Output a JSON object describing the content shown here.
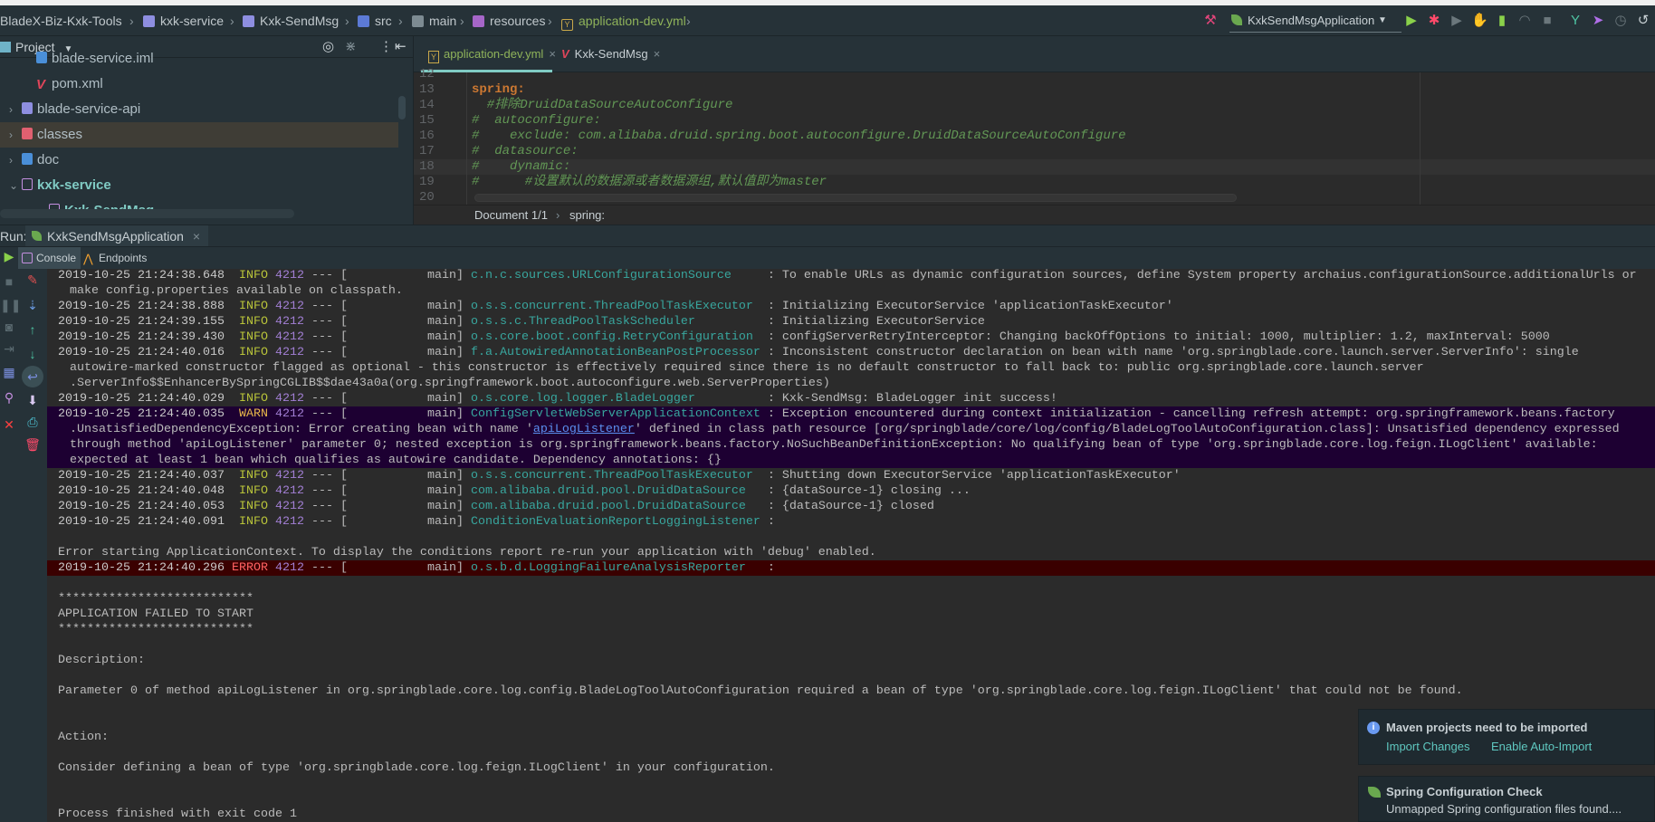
{
  "breadcrumb": [
    {
      "label": "BladeX-Biz-Kxk-Tools",
      "icon": "none"
    },
    {
      "label": "kxk-service",
      "icon": "module-folder-icon"
    },
    {
      "label": "Kxk-SendMsg",
      "icon": "module-folder-icon"
    },
    {
      "label": "src",
      "icon": "source-folder-icon"
    },
    {
      "label": "main",
      "icon": "folder-icon"
    },
    {
      "label": "resources",
      "icon": "resources-folder-icon"
    },
    {
      "label": "application-dev.yml",
      "icon": "yaml-file-icon"
    }
  ],
  "toolbar": {
    "run_config": "KxkSendMsgApplication"
  },
  "project": {
    "title": "Project",
    "items": [
      {
        "label": "blade-service.iml",
        "depth": 2,
        "expanded": null,
        "icon": "iml-file-icon"
      },
      {
        "label": "pom.xml",
        "depth": 2,
        "expanded": null,
        "icon": "maven-file-icon"
      },
      {
        "label": "blade-service-api",
        "depth": 1,
        "expanded": false,
        "icon": "module-folder-icon"
      },
      {
        "label": "classes",
        "depth": 1,
        "expanded": false,
        "icon": "excluded-folder-icon",
        "selected": true
      },
      {
        "label": "doc",
        "depth": 1,
        "expanded": false,
        "icon": "doc-folder-icon"
      },
      {
        "label": "kxk-service",
        "depth": 1,
        "expanded": true,
        "icon": "module-folder-icon"
      },
      {
        "label": "Kxk-SendMsg",
        "depth": 2,
        "expanded": true,
        "icon": "module-folder-icon"
      }
    ]
  },
  "editor": {
    "tabs": [
      {
        "label": "application-dev.yml",
        "active": true
      },
      {
        "label": "Kxk-SendMsg",
        "active": false
      }
    ],
    "lines": [
      {
        "n": "12",
        "text": "",
        "style": "plain"
      },
      {
        "n": "13",
        "text": "spring:",
        "style": "kw"
      },
      {
        "n": "14",
        "text": "  #排除DruidDataSourceAutoConfigure",
        "style": "cm"
      },
      {
        "n": "15",
        "text": "#  autoconfigure:",
        "style": "cm"
      },
      {
        "n": "16",
        "text": "#    exclude: com.alibaba.druid.spring.boot.autoconfigure.DruidDataSourceAutoConfigure",
        "style": "cm"
      },
      {
        "n": "17",
        "text": "#  datasource:",
        "style": "cm"
      },
      {
        "n": "18",
        "text": "#    dynamic:",
        "style": "cm"
      },
      {
        "n": "19",
        "text": "#      #设置默认的数据源或者数据源组,默认值即为master",
        "style": "cm"
      },
      {
        "n": "20",
        "text": "",
        "style": "plain"
      }
    ],
    "footer": [
      "Document 1/1",
      "spring:"
    ]
  },
  "run": {
    "label": "Run:",
    "tab": "KxkSendMsgApplication"
  },
  "console_tabs": [
    "Console",
    "Endpoints"
  ],
  "console": [
    {
      "kind": "log",
      "ts": "2019-10-25 21:24:38.648",
      "level": "INFO",
      "pid": "4212",
      "thread": "main",
      "logger": "c.n.c.sources.URLConfigurationSource",
      "msg": "To enable URLs as dynamic configuration sources, define System property archaius.configurationSource.additionalUrls or"
    },
    {
      "kind": "cont",
      "text": "make config.properties available on classpath."
    },
    {
      "kind": "log",
      "ts": "2019-10-25 21:24:38.888",
      "level": "INFO",
      "pid": "4212",
      "thread": "main",
      "logger": "o.s.s.concurrent.ThreadPoolTaskExecutor",
      "msg": "Initializing ExecutorService 'applicationTaskExecutor'"
    },
    {
      "kind": "log",
      "ts": "2019-10-25 21:24:39.155",
      "level": "INFO",
      "pid": "4212",
      "thread": "main",
      "logger": "o.s.s.c.ThreadPoolTaskScheduler",
      "msg": "Initializing ExecutorService"
    },
    {
      "kind": "log",
      "ts": "2019-10-25 21:24:39.430",
      "level": "INFO",
      "pid": "4212",
      "thread": "main",
      "logger": "o.s.core.boot.config.RetryConfiguration",
      "msg": "configServerRetryInterceptor: Changing backOffOptions to initial: 1000, multiplier: 1.2, maxInterval: 5000"
    },
    {
      "kind": "log",
      "ts": "2019-10-25 21:24:40.016",
      "level": "INFO",
      "pid": "4212",
      "thread": "main",
      "logger": "f.a.AutowiredAnnotationBeanPostProcessor",
      "msg": "Inconsistent constructor declaration on bean with name 'org.springblade.core.launch.server.ServerInfo': single"
    },
    {
      "kind": "cont",
      "text": "autowire-marked constructor flagged as optional - this constructor is effectively required since there is no default constructor to fall back to: public org.springblade.core.launch.server"
    },
    {
      "kind": "cont",
      "text": ".ServerInfo$$EnhancerBySpringCGLIB$$dae43a0a(org.springframework.boot.autoconfigure.web.ServerProperties)"
    },
    {
      "kind": "log",
      "ts": "2019-10-25 21:24:40.029",
      "level": "INFO",
      "pid": "4212",
      "thread": "main",
      "logger": "o.s.core.log.logger.BladeLogger",
      "msg": "Kxk-SendMsg: BladeLogger init success!"
    },
    {
      "kind": "log",
      "ts": "2019-10-25 21:24:40.035",
      "level": "WARN",
      "pid": "4212",
      "thread": "main",
      "logger": "ConfigServletWebServerApplicationContext",
      "msg": "Exception encountered during context initialization - cancelling refresh attempt: org.springframework.beans.factory",
      "hl": "warn"
    },
    {
      "kind": "cont",
      "text": ".UnsatisfiedDependencyException: Error creating bean with name '",
      "link": "apiLogListener",
      "after": "' defined in class path resource [org/springblade/core/log/config/BladeLogToolAutoConfiguration.class]: Unsatisfied dependency expressed",
      "hl": "warn"
    },
    {
      "kind": "cont",
      "text": "through method 'apiLogListener' parameter 0; nested exception is org.springframework.beans.factory.NoSuchBeanDefinitionException: No qualifying bean of type 'org.springblade.core.log.feign.ILogClient' available:",
      "hl": "warn"
    },
    {
      "kind": "cont",
      "text": "expected at least 1 bean which qualifies as autowire candidate. Dependency annotations: {}",
      "hl": "warn"
    },
    {
      "kind": "log",
      "ts": "2019-10-25 21:24:40.037",
      "level": "INFO",
      "pid": "4212",
      "thread": "main",
      "logger": "o.s.s.concurrent.ThreadPoolTaskExecutor",
      "msg": "Shutting down ExecutorService 'applicationTaskExecutor'"
    },
    {
      "kind": "log",
      "ts": "2019-10-25 21:24:40.048",
      "level": "INFO",
      "pid": "4212",
      "thread": "main",
      "logger": "com.alibaba.druid.pool.DruidDataSource",
      "msg": "{dataSource-1} closing ..."
    },
    {
      "kind": "log",
      "ts": "2019-10-25 21:24:40.053",
      "level": "INFO",
      "pid": "4212",
      "thread": "main",
      "logger": "com.alibaba.druid.pool.DruidDataSource",
      "msg": "{dataSource-1} closed"
    },
    {
      "kind": "log",
      "ts": "2019-10-25 21:24:40.091",
      "level": "INFO",
      "pid": "4212",
      "thread": "main",
      "logger": "ConditionEvaluationReportLoggingListener",
      "msg": ""
    },
    {
      "kind": "text",
      "text": ""
    },
    {
      "kind": "text",
      "text": "Error starting ApplicationContext. To display the conditions report re-run your application with 'debug' enabled."
    },
    {
      "kind": "log",
      "ts": "2019-10-25 21:24:40.296",
      "level": "ERROR",
      "pid": "4212",
      "thread": "main",
      "logger": "o.s.b.d.LoggingFailureAnalysisReporter",
      "msg": "",
      "hl": "error"
    },
    {
      "kind": "text",
      "text": ""
    },
    {
      "kind": "text",
      "text": "***************************"
    },
    {
      "kind": "text",
      "text": "APPLICATION FAILED TO START"
    },
    {
      "kind": "text",
      "text": "***************************"
    },
    {
      "kind": "text",
      "text": ""
    },
    {
      "kind": "text",
      "text": "Description:"
    },
    {
      "kind": "text",
      "text": ""
    },
    {
      "kind": "text",
      "text": "Parameter 0 of method apiLogListener in org.springblade.core.log.config.BladeLogToolAutoConfiguration required a bean of type 'org.springblade.core.log.feign.ILogClient' that could not be found."
    },
    {
      "kind": "text",
      "text": ""
    },
    {
      "kind": "text",
      "text": ""
    },
    {
      "kind": "text",
      "text": "Action:"
    },
    {
      "kind": "text",
      "text": ""
    },
    {
      "kind": "text",
      "text": "Consider defining a bean of type 'org.springblade.core.log.feign.ILogClient' in your configuration."
    },
    {
      "kind": "text",
      "text": ""
    },
    {
      "kind": "text",
      "text": ""
    },
    {
      "kind": "text",
      "text": "Process finished with exit code 1"
    }
  ],
  "notifications": [
    {
      "title": "Maven projects need to be imported",
      "icon": "info-icon",
      "actions": [
        "Import Changes",
        "Enable Auto-Import"
      ]
    },
    {
      "title": "Spring Configuration Check",
      "icon": "spring-leaf-icon",
      "body": "Unmapped Spring configuration files found...."
    }
  ],
  "colors": {
    "background": "#2b2b2b",
    "panel": "#263238",
    "info": "#b9c43a",
    "warn": "#e8b84a",
    "error": "#ff6262",
    "logger": "#38a69e",
    "pid": "#a27fd4",
    "link": "#5b8ff0",
    "warn_bg": "#1d0032",
    "error_bg": "#3a0000"
  }
}
